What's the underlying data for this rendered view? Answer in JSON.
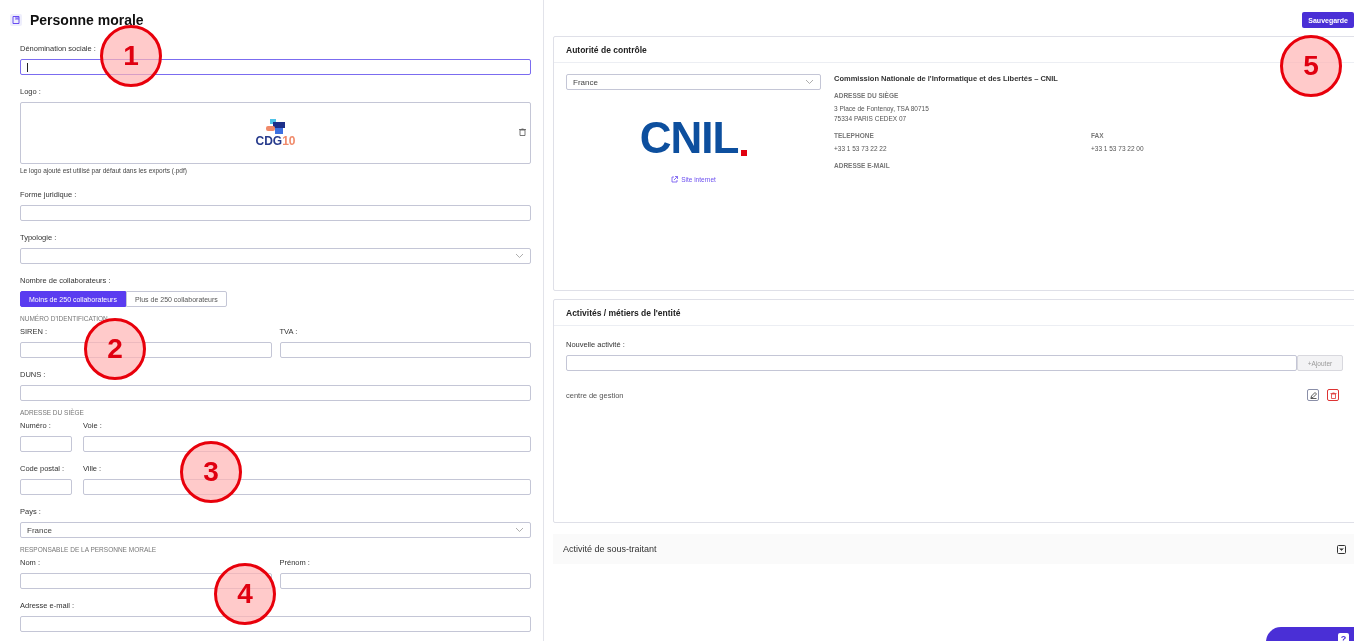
{
  "title": "Personne morale",
  "save_button": "Sauvegarde",
  "form": [
    {
      "kind": "field",
      "label": "Dénomination sociale :",
      "focused": true
    },
    {
      "kind": "logo",
      "label": "Logo :",
      "logo_text": "CDG",
      "logo_number": "10",
      "hint": "Le logo ajouté est utilisé par défaut dans les exports (.pdf)"
    },
    {
      "kind": "field",
      "label": "Forme juridique :",
      "focused": false
    },
    {
      "kind": "select",
      "label": "Typologie :"
    },
    {
      "kind": "toggle",
      "label": "Nombre de collaborateurs :",
      "options": [
        {
          "label": "Moins de 250 collaborateurs",
          "selected": true
        },
        {
          "label": "Plus de 250 collaborateurs",
          "selected": false
        }
      ]
    },
    {
      "kind": "section",
      "title": "NUMÉRO D'IDENTIFICATION"
    },
    {
      "kind": "pair",
      "fields": [
        {
          "label": "SIREN :"
        },
        {
          "label": "TVA :"
        }
      ]
    },
    {
      "kind": "field",
      "label": "DUNS :",
      "focused": false
    },
    {
      "kind": "section",
      "title": "ADRESSE DU SIÈGE"
    },
    {
      "kind": "split",
      "fields": [
        {
          "label": "Numéro :"
        },
        {
          "label": "Voie :"
        }
      ]
    },
    {
      "kind": "split",
      "fields": [
        {
          "label": "Code postal :"
        },
        {
          "label": "Ville :"
        }
      ]
    },
    {
      "kind": "select",
      "label": "Pays :",
      "value": "France"
    },
    {
      "kind": "section",
      "title": "RESPONSABLE DE LA PERSONNE MORALE"
    },
    {
      "kind": "pair",
      "fields": [
        {
          "label": "Nom :"
        },
        {
          "label": "Prénom :"
        }
      ]
    },
    {
      "kind": "field",
      "label": "Adresse e-mail :",
      "focused": false
    }
  ],
  "authority": {
    "title": "Autorité de contrôle",
    "country": "France",
    "logo_text": "CNIL",
    "link": "Site internet",
    "name": "Commission Nationale de l'Informatique et des Libertés – CNIL",
    "address_label": "ADRESSE DU SIÈGE",
    "address_lines": [
      "3 Place de Fontenoy, TSA 80715",
      "75334 PARIS CEDEX 07"
    ],
    "phone_label": "TELEPHONE",
    "phone": "+33 1 53 73 22 22",
    "fax_label": "FAX",
    "fax": "+33 1 53 73 22 00",
    "email_label": "ADRESSE E-MAIL"
  },
  "activities": {
    "title": "Activités / métiers de l'entité",
    "new_label": "Nouvelle activité :",
    "add_button": "+Ajouter",
    "items": [
      "centre de gestion"
    ]
  },
  "subcontractor": {
    "title": "Activité de sous-traitant",
    "expanded": false
  },
  "help_button": {
    "icon": "?"
  },
  "callouts": [
    "1",
    "2",
    "3",
    "4",
    "5"
  ]
}
